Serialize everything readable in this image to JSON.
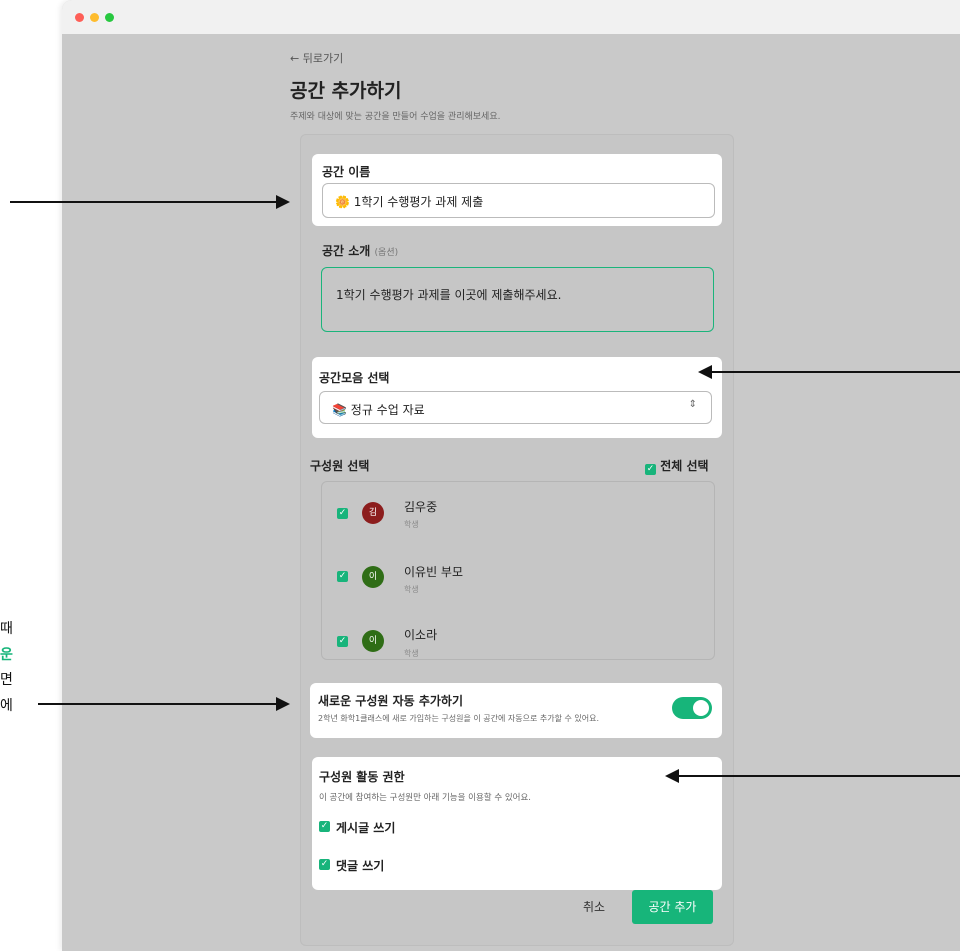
{
  "back_label": "뒤로가기",
  "page": {
    "title": "공간 추가하기",
    "subtitle": "주제와 대상에 맞는 공간을 만들어 수업을 관리해보세요."
  },
  "space_name": {
    "label": "공간 이름",
    "emoji": "🌼",
    "value": "1학기 수행평가 과제 제출"
  },
  "space_intro": {
    "label": "공간 소개",
    "hint": "(옵션)",
    "value": "1학기 수행평가 과제를 이곳에 제출해주세요."
  },
  "collection": {
    "label": "공간모음 선택",
    "emoji": "📚",
    "value": "정규 수업 자료",
    "caret": "⌃⌄"
  },
  "members": {
    "label": "구성원 선택",
    "select_all": "전체 선택",
    "items": [
      {
        "initial": "김",
        "name": "김우중",
        "role": "학생",
        "color": "#8c1d1d"
      },
      {
        "initial": "이",
        "name": "이유빈 부모",
        "role": "학생",
        "color": "#2f6d16"
      },
      {
        "initial": "이",
        "name": "이소라",
        "role": "학생",
        "color": "#2f6d16"
      }
    ]
  },
  "auto_add": {
    "label": "새로운 구성원 자동 추가하기",
    "description": "2학년 화학1클래스에 새로 가입하는 구성원을 이 공간에 자동으로 추가할 수 있어요.",
    "enabled": true
  },
  "permissions": {
    "label": "구성원 활동 권한",
    "description": "이 공간에 참여하는 구성원만 아래 기능을 이용할 수 있어요.",
    "items": [
      "게시글 쓰기",
      "댓글 쓰기"
    ]
  },
  "footer": {
    "cancel": "취소",
    "submit": "공간 추가"
  },
  "side_texts": [
    "때",
    "운",
    "면",
    "에"
  ],
  "colors": {
    "accent": "#17b57a",
    "overlay": "#c9c9c9"
  }
}
